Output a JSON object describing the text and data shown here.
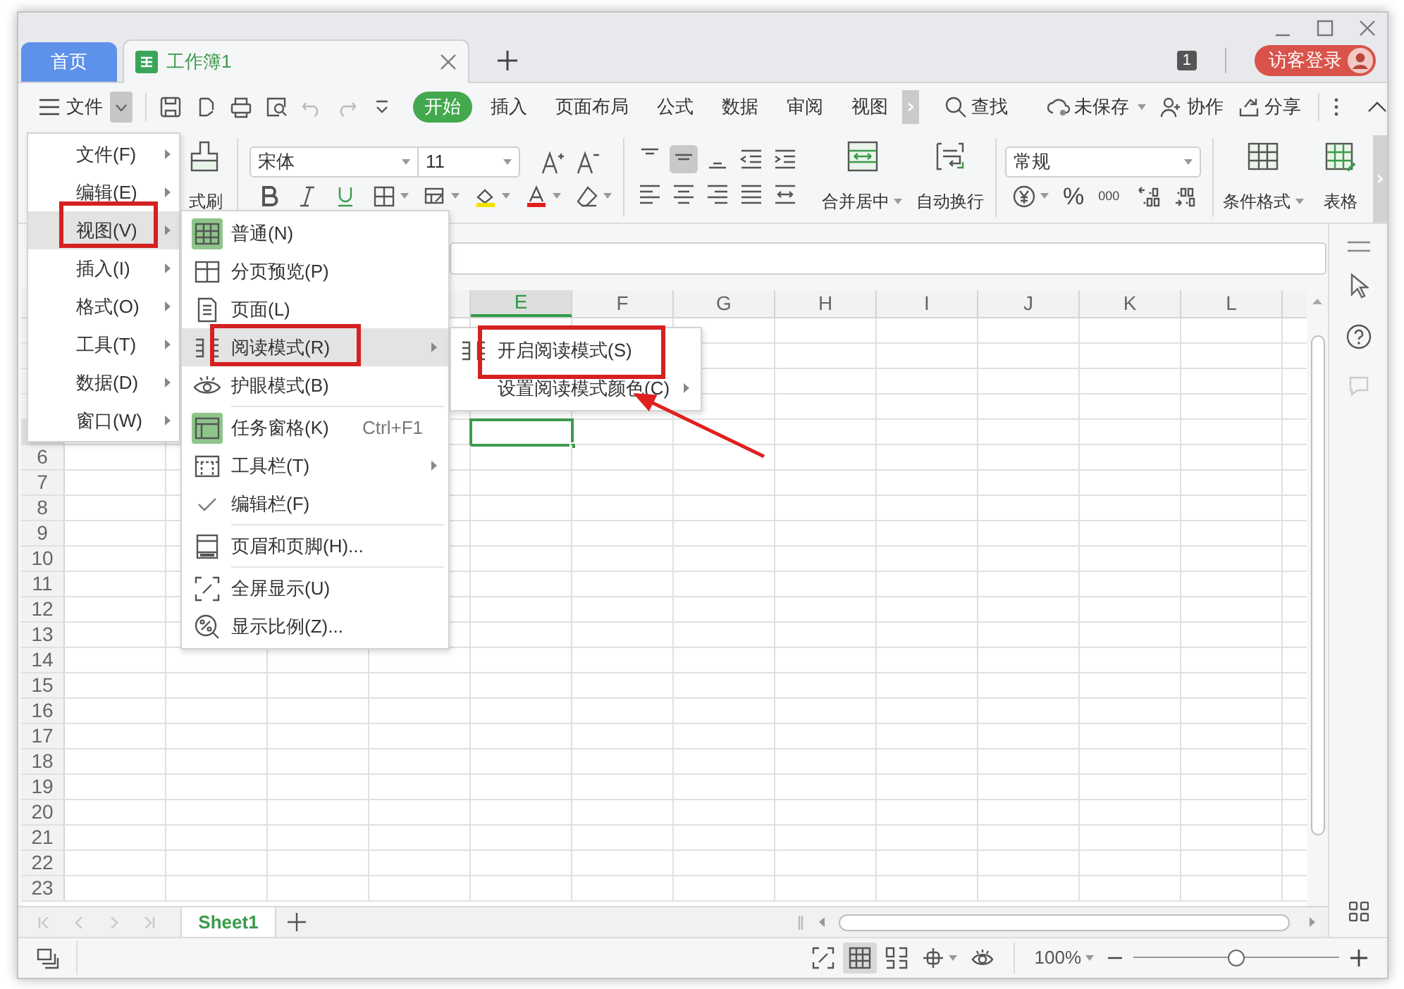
{
  "window": {
    "tabs": [
      {
        "label": "首页",
        "kind": "home",
        "selected": false
      },
      {
        "label": "工作簿1",
        "kind": "sheet",
        "selected": true
      }
    ],
    "window_count": "1",
    "login_button": "访客登录"
  },
  "toolbar": {
    "menu_label": "文件",
    "menu_open": true,
    "ribbon_tabs": [
      {
        "label": "开始",
        "selected": true
      },
      {
        "label": "插入",
        "selected": false
      },
      {
        "label": "页面布局",
        "selected": false
      },
      {
        "label": "公式",
        "selected": false
      },
      {
        "label": "数据",
        "selected": false
      },
      {
        "label": "审阅",
        "selected": false
      },
      {
        "label": "视图",
        "selected": false
      }
    ],
    "actions": [
      {
        "label": "查找",
        "kind": "search"
      },
      {
        "label": "未保存",
        "kind": "cloud"
      },
      {
        "label": "协作",
        "kind": "collab"
      },
      {
        "label": "分享",
        "kind": "share"
      }
    ]
  },
  "ribbon": {
    "format_painter": "式刷",
    "font_name": "宋体",
    "font_size": "11",
    "merge_button": "合并居中",
    "wrap_button": "自动换行",
    "number_format": "常规",
    "percent": "%",
    "thousands": "000",
    "conditional_format": "条件格式",
    "table_style": "表格"
  },
  "sheet": {
    "columns": [
      {},
      {},
      {},
      {},
      {
        "label": "E",
        "selected": true
      },
      {
        "label": "F",
        "selected": false
      },
      {
        "label": "G",
        "selected": false
      },
      {
        "label": "H",
        "selected": false
      },
      {
        "label": "I",
        "selected": false
      },
      {
        "label": "J",
        "selected": false
      },
      {
        "label": "K",
        "selected": false
      },
      {
        "label": "L",
        "selected": false
      }
    ],
    "rows": [
      {},
      {},
      {},
      {},
      {
        "selected": true
      },
      {
        "label": "6",
        "selected": false
      },
      {
        "label": "7",
        "selected": false
      },
      {
        "label": "8",
        "selected": false
      },
      {
        "label": "9",
        "selected": false
      },
      {
        "label": "10",
        "selected": false
      },
      {
        "label": "11",
        "selected": false
      },
      {
        "label": "12",
        "selected": false
      },
      {
        "label": "13",
        "selected": false
      },
      {
        "label": "14",
        "selected": false
      },
      {
        "label": "15",
        "selected": false
      },
      {
        "label": "16",
        "selected": false
      },
      {
        "label": "17",
        "selected": false
      },
      {
        "label": "18",
        "selected": false
      },
      {
        "label": "19",
        "selected": false
      },
      {
        "label": "20",
        "selected": false
      },
      {
        "label": "21",
        "selected": false
      },
      {
        "label": "22",
        "selected": false
      },
      {
        "label": "23",
        "selected": false
      }
    ]
  },
  "sheet_tabs": [
    {
      "label": "Sheet1",
      "selected": true
    }
  ],
  "status_bar": {
    "view_buttons": [
      {
        "selected": false
      },
      {
        "selected": true
      },
      {
        "selected": false
      },
      {
        "selected": false
      },
      {
        "selected": false
      }
    ],
    "zoom": {
      "label": "100%",
      "level": 0.5
    }
  },
  "menus": [
    {
      "items": [
        {
          "kind": "item",
          "label": "文件(F)",
          "submenu": true,
          "selected": false,
          "annotated": false
        },
        {
          "kind": "item",
          "label": "编辑(E)",
          "submenu": true,
          "selected": false,
          "annotated": false
        },
        {
          "kind": "item",
          "label": "视图(V)",
          "submenu": true,
          "selected": true,
          "annotated": true
        },
        {
          "kind": "item",
          "label": "插入(I)",
          "submenu": true,
          "selected": false,
          "annotated": false
        },
        {
          "kind": "item",
          "label": "格式(O)",
          "submenu": true,
          "selected": false,
          "annotated": false
        },
        {
          "kind": "item",
          "label": "工具(T)",
          "submenu": true,
          "selected": false,
          "annotated": false
        },
        {
          "kind": "item",
          "label": "数据(D)",
          "submenu": true,
          "selected": false,
          "annotated": false
        },
        {
          "kind": "item",
          "label": "窗口(W)",
          "submenu": true,
          "selected": false,
          "annotated": false
        }
      ]
    },
    {
      "items": [
        {
          "kind": "item",
          "label": "普通(N)",
          "checked": true,
          "selected": false,
          "annotated": false
        },
        {
          "kind": "item",
          "label": "分页预览(P)",
          "checked": false,
          "selected": false,
          "annotated": false
        },
        {
          "kind": "item",
          "label": "页面(L)",
          "checked": false,
          "selected": false,
          "annotated": false
        },
        {
          "kind": "item",
          "label": "阅读模式(R)",
          "submenu": true,
          "checked": false,
          "selected": true,
          "annotated": true
        },
        {
          "kind": "item",
          "label": "护眼模式(B)",
          "checked": false,
          "selected": false,
          "annotated": false
        },
        {
          "kind": "separator"
        },
        {
          "kind": "item",
          "label": "任务窗格(K)",
          "shortcut": "Ctrl+F1",
          "checked": true,
          "selected": false,
          "annotated": false
        },
        {
          "kind": "item",
          "label": "工具栏(T)",
          "submenu": true,
          "checked": false,
          "selected": false,
          "annotated": false
        },
        {
          "kind": "item",
          "label": "编辑栏(F)",
          "checked": true,
          "selected": false,
          "annotated": false
        },
        {
          "kind": "separator"
        },
        {
          "kind": "item",
          "label": "页眉和页脚(H)...",
          "checked": false,
          "selected": false,
          "annotated": false
        },
        {
          "kind": "separator"
        },
        {
          "kind": "item",
          "label": "全屏显示(U)",
          "checked": false,
          "selected": false,
          "annotated": false
        },
        {
          "kind": "item",
          "label": "显示比例(Z)...",
          "checked": false,
          "selected": false,
          "annotated": false
        }
      ]
    },
    {
      "items": [
        {
          "kind": "item",
          "label": "开启阅读模式(S)",
          "selected": false,
          "annotated": true
        },
        {
          "kind": "item",
          "label": "设置阅读模式颜色(C)",
          "submenu": true,
          "selected": false,
          "annotated": false
        }
      ]
    }
  ],
  "annotation": {
    "arrow": true
  }
}
